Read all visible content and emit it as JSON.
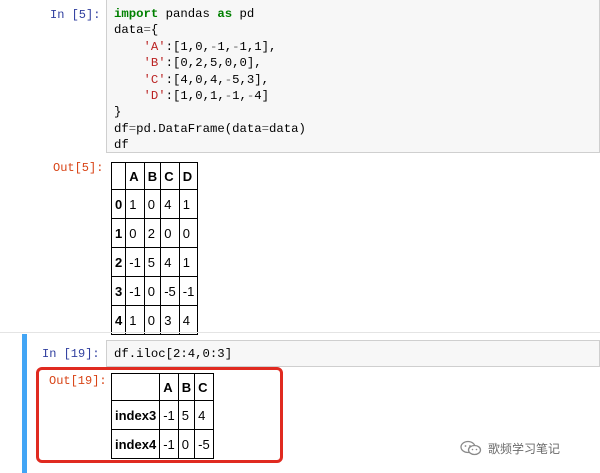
{
  "cells": [
    {
      "prompt": "In  [5]:",
      "code_lines": [
        [
          {
            "t": "import",
            "c": "kw"
          },
          {
            "t": " pandas ",
            "c": ""
          },
          {
            "t": "as",
            "c": "kw"
          },
          {
            "t": " pd",
            "c": ""
          }
        ],
        [
          {
            "t": "data",
            "c": ""
          },
          {
            "t": "=",
            "c": "op"
          },
          {
            "t": "{",
            "c": ""
          }
        ],
        [
          {
            "t": "    ",
            "c": ""
          },
          {
            "t": "'A'",
            "c": "str"
          },
          {
            "t": ":[1,0,",
            "c": ""
          },
          {
            "t": "-",
            "c": "op"
          },
          {
            "t": "1,",
            "c": ""
          },
          {
            "t": "-",
            "c": "op"
          },
          {
            "t": "1,1],",
            "c": ""
          }
        ],
        [
          {
            "t": "    ",
            "c": ""
          },
          {
            "t": "'B'",
            "c": "str"
          },
          {
            "t": ":[0,2,5,0,0],",
            "c": ""
          }
        ],
        [
          {
            "t": "    ",
            "c": ""
          },
          {
            "t": "'C'",
            "c": "str"
          },
          {
            "t": ":[4,0,4,",
            "c": ""
          },
          {
            "t": "-",
            "c": "op"
          },
          {
            "t": "5,3],",
            "c": ""
          }
        ],
        [
          {
            "t": "    ",
            "c": ""
          },
          {
            "t": "'D'",
            "c": "str"
          },
          {
            "t": ":[1,0,1,",
            "c": ""
          },
          {
            "t": "-",
            "c": "op"
          },
          {
            "t": "1,",
            "c": ""
          },
          {
            "t": "-",
            "c": "op"
          },
          {
            "t": "4]",
            "c": ""
          }
        ],
        [
          {
            "t": "}",
            "c": ""
          }
        ],
        [
          {
            "t": "df",
            "c": ""
          },
          {
            "t": "=",
            "c": "op"
          },
          {
            "t": "pd.DataFrame(data",
            "c": ""
          },
          {
            "t": "=",
            "c": "op"
          },
          {
            "t": "data)",
            "c": ""
          }
        ],
        [
          {
            "t": "df",
            "c": ""
          }
        ]
      ],
      "out_prompt": "Out[5]:",
      "table": {
        "columns": [
          "",
          "A",
          "B",
          "C",
          "D"
        ],
        "rows": [
          {
            "index": "0",
            "values": [
              "1",
              "0",
              "4",
              "1"
            ]
          },
          {
            "index": "1",
            "values": [
              "0",
              "2",
              "0",
              "0"
            ]
          },
          {
            "index": "2",
            "values": [
              "-1",
              "5",
              "4",
              "1"
            ]
          },
          {
            "index": "3",
            "values": [
              "-1",
              "0",
              "-5",
              "-1"
            ]
          },
          {
            "index": "4",
            "values": [
              "1",
              "0",
              "3",
              "4"
            ]
          }
        ]
      }
    },
    {
      "prompt": "In  [19]:",
      "code_lines": [
        [
          {
            "t": "df.iloc[2:4,0:3]",
            "c": ""
          }
        ]
      ],
      "out_prompt": "Out[19]:",
      "table": {
        "columns": [
          "",
          "A",
          "B",
          "C"
        ],
        "rows": [
          {
            "index": "index3",
            "values": [
              "-1",
              "5",
              "4"
            ]
          },
          {
            "index": "index4",
            "values": [
              "-1",
              "0",
              "-5"
            ]
          }
        ]
      }
    }
  ],
  "watermark": {
    "text": "歌频学习笔记",
    "icon": "wechat-icon"
  },
  "colors": {
    "prompt_in": "#303f9f",
    "prompt_out": "#d84315",
    "selected_border": "#42a5f5",
    "highlight": "#e02a20"
  }
}
